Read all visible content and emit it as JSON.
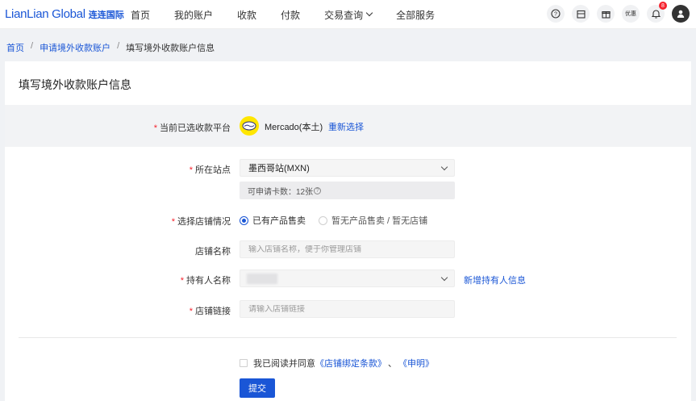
{
  "brand": {
    "logo_en": "LianLian Global",
    "logo_cn": "连连国际"
  },
  "nav": {
    "items": [
      {
        "label": "首页"
      },
      {
        "label": "我的账户"
      },
      {
        "label": "收款"
      },
      {
        "label": "付款"
      },
      {
        "label": "交易查询"
      },
      {
        "label": "全部服务"
      }
    ]
  },
  "top_icons": {
    "help": "?",
    "calendar": "",
    "gift": "",
    "vip": "优惠",
    "notification_count": "8"
  },
  "breadcrumb": [
    "首页",
    "申请境外收款账户",
    "填写境外收款账户信息"
  ],
  "page": {
    "title": "填写境外收款账户信息"
  },
  "form": {
    "platform": {
      "label": "当前已选收款平台",
      "name": "Mercado(本土)",
      "reselect": "重新选择"
    },
    "site": {
      "label": "所在站点",
      "value": "墨西哥站(MXN)",
      "card_quota": "可申请卡数：12张"
    },
    "store_status": {
      "label": "选择店铺情况",
      "options": [
        {
          "label": "已有产品售卖",
          "selected": true
        },
        {
          "label": "暂无产品售卖 / 暂无店铺",
          "selected": false
        }
      ]
    },
    "store_name": {
      "label": "店铺名称",
      "placeholder": "输入店铺名称，便于你管理店铺"
    },
    "holder": {
      "label": "持有人名称",
      "add_link": "新增持有人信息"
    },
    "store_link": {
      "label": "店铺链接",
      "placeholder": "请输入店铺链接"
    },
    "agreement": {
      "prefix": "我已阅读并同意",
      "doc1": "《店铺绑定条款》",
      "sep": "、",
      "doc2": "《申明》"
    },
    "submit": "提交"
  },
  "colors": {
    "primary": "#1a56d6",
    "required": "#f5222d",
    "platform_yellow": "#ffe600"
  }
}
